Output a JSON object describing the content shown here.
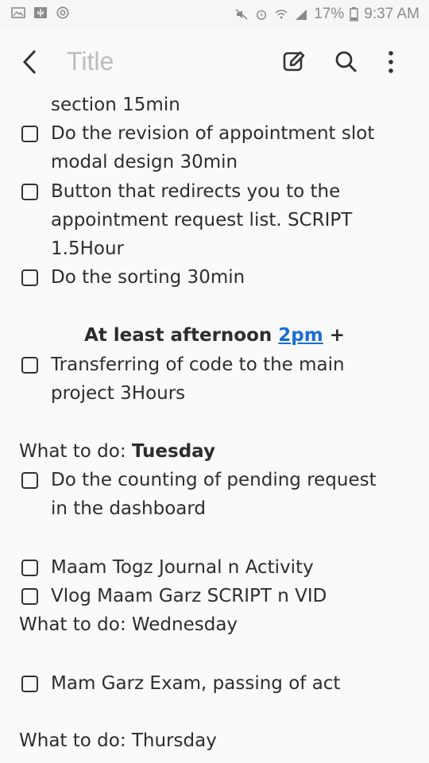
{
  "status_bar": {
    "battery": "17%",
    "time": "9:37 AM"
  },
  "app_bar": {
    "title_placeholder": "Title"
  },
  "note": {
    "lines": [
      {
        "text": "section 15min"
      },
      {
        "text": "Do the revision of appointment slot",
        "checkbox": true
      },
      {
        "text": "modal design 30min"
      },
      {
        "text": "Button that redirects you to the",
        "checkbox": true
      },
      {
        "text": "appointment request list. SCRIPT"
      },
      {
        "text": "1.5Hour"
      },
      {
        "text": "Do the sorting 30min",
        "checkbox": true
      }
    ],
    "afternoon": {
      "prefix": "At least afternoon",
      "link": "2pm",
      "suffix": "+"
    },
    "transfer": {
      "line1": "Transferring of code to the main",
      "line2": "project 3Hours"
    },
    "tuesday": {
      "label": "What to do:",
      "day": "Tuesday"
    },
    "counting": {
      "line1": "Do the counting of pending request",
      "line2": "in the dashboard"
    },
    "journal": "Maam Togz Journal n Activity",
    "vlog": "Vlog Maam Garz SCRIPT n VID",
    "wednesday": "What to do: Wednesday",
    "exam": "Mam Garz Exam, passing of act",
    "thursday": "What to do: Thursday"
  }
}
